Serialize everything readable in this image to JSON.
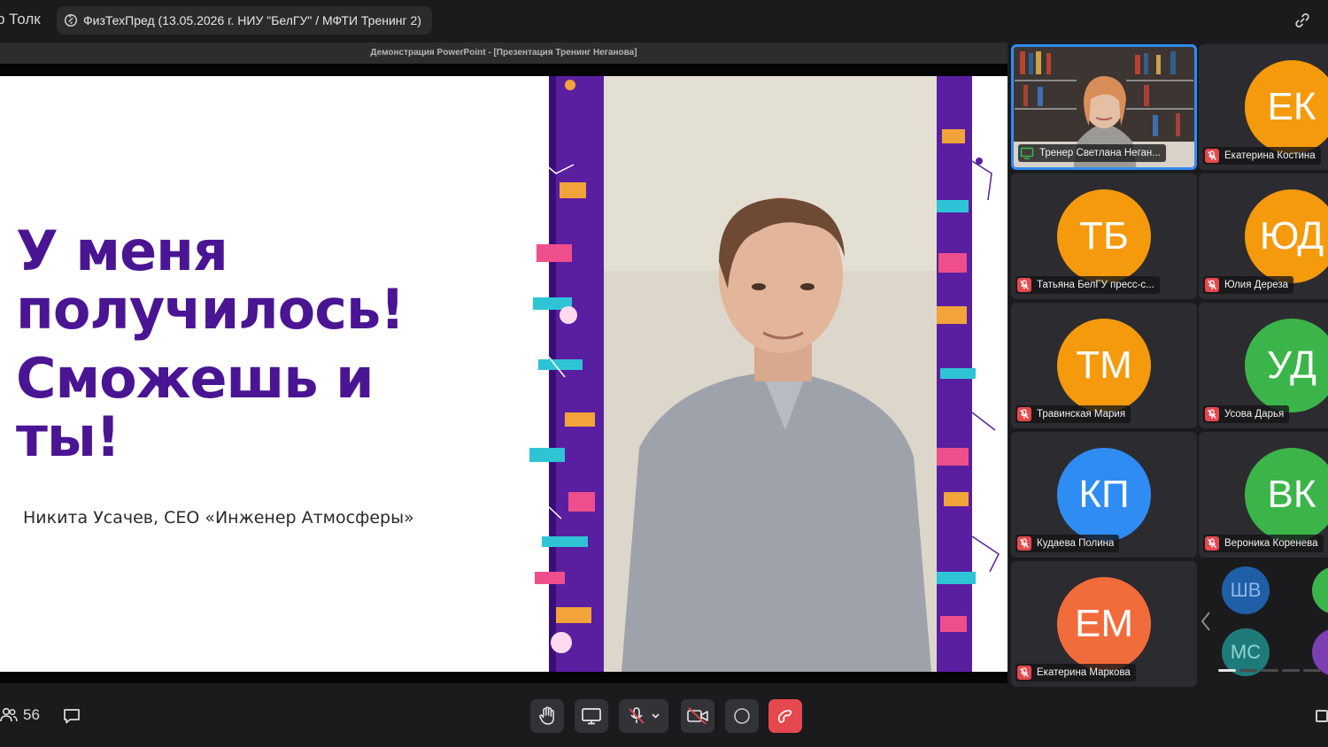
{
  "app": {
    "name": "р Толк"
  },
  "meeting": {
    "title": "ФизТехПред (13.05.2026 г. НИУ \"БелГУ\" / МФТИ Тренинг 2)"
  },
  "share": {
    "window_title": "Демонстрация PowerPoint - [Презентация Тренинг Неганова]",
    "slide": {
      "headline_1": "У меня",
      "headline_2": "получилось!",
      "headline_3": "Сможешь и",
      "headline_4": "ты!",
      "author": "Никита Усачев, CEO «Инженер Атмосферы»"
    }
  },
  "participants": [
    {
      "name": "Тренер Светлана Неган...",
      "type": "video",
      "active": true,
      "sharing": true
    },
    {
      "name": "Екатерина Костина",
      "initials": "ЕК",
      "color": "#f59a0c",
      "muted": true
    },
    {
      "name": "Татьяна БелГУ пресс-с...",
      "initials": "ТБ",
      "color": "#f59a0c",
      "muted": true
    },
    {
      "name": "Юлия Дереза",
      "initials": "ЮД",
      "color": "#f59a0c",
      "muted": true
    },
    {
      "name": "Травинская Мария",
      "initials": "ТМ",
      "color": "#f59a0c",
      "muted": true
    },
    {
      "name": "Усова Дарья",
      "initials": "УД",
      "color": "#3bb54a",
      "muted": true
    },
    {
      "name": "Кудаева Полина",
      "initials": "КП",
      "color": "#2f8cf3",
      "muted": true
    },
    {
      "name": "Вероника Коренева",
      "initials": "ВК",
      "color": "#3bb54a",
      "muted": true
    },
    {
      "name": "Екатерина Маркова",
      "initials": "ЕМ",
      "color": "#f26b3a",
      "muted": true
    }
  ],
  "mini_participants": [
    {
      "initials": "ШВ",
      "color": "#1f5fa8"
    },
    {
      "initials": "МС",
      "color": "#1f7a7a"
    }
  ],
  "toolbar": {
    "participants_count": "56",
    "icons": [
      "people-icon",
      "chat-icon",
      "raise-hand-icon",
      "screen-share-icon",
      "mic-off-icon",
      "camera-off-icon",
      "record-icon",
      "hang-up-icon"
    ]
  },
  "colors": {
    "accent": "#2f8cf3",
    "slide_purple": "#4a1593",
    "end_call": "#e5484d",
    "avatar_orange": "#f59a0c",
    "avatar_green": "#3bb54a",
    "avatar_blue": "#2f8cf3"
  }
}
